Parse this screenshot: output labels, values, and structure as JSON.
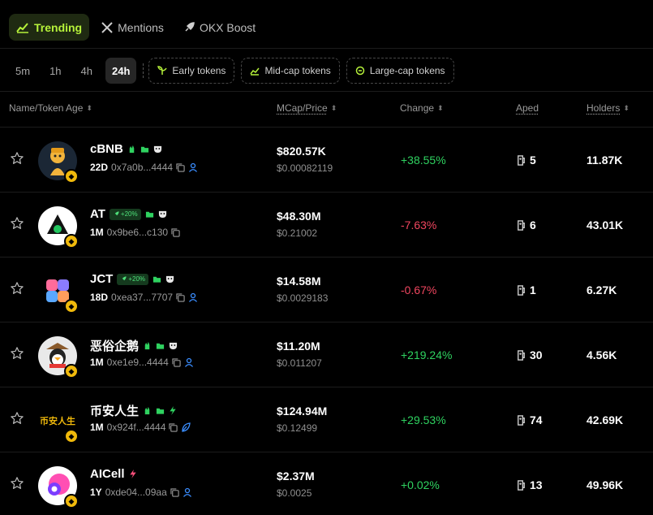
{
  "tabs": {
    "trending": "Trending",
    "mentions": "Mentions",
    "boost": "OKX Boost"
  },
  "time_filters": [
    "5m",
    "1h",
    "4h",
    "24h"
  ],
  "active_time_filter": "24h",
  "chips": {
    "early": "Early tokens",
    "mid": "Mid-cap tokens",
    "large": "Large-cap tokens"
  },
  "headers": {
    "name": "Name/Token Age",
    "mcap": "MCap/Price",
    "change": "Change",
    "aped": "Aped",
    "holders": "Holders"
  },
  "boost_label": "+20%",
  "avatar_text": {
    "bian": "币安人生"
  },
  "colors": {
    "accent": "#b6f23a",
    "up": "#2fd260",
    "down": "#f0465f",
    "bnb": "#f0b90b"
  },
  "rows": [
    {
      "name": "cBNB",
      "age": "22D",
      "addr": "0x7a0b...4444",
      "mcap": "$820.57K",
      "price": "$0.00082119",
      "change": "+38.55%",
      "dir": "up",
      "aped": "5",
      "holders": "11.87K"
    },
    {
      "name": "AT",
      "age": "1M",
      "addr": "0x9be6...c130",
      "mcap": "$48.30M",
      "price": "$0.21002",
      "change": "-7.63%",
      "dir": "down",
      "aped": "6",
      "holders": "43.01K"
    },
    {
      "name": "JCT",
      "age": "18D",
      "addr": "0xea37...7707",
      "mcap": "$14.58M",
      "price": "$0.0029183",
      "change": "-0.67%",
      "dir": "down",
      "aped": "1",
      "holders": "6.27K"
    },
    {
      "name": "恶俗企鹅",
      "age": "1M",
      "addr": "0xe1e9...4444",
      "mcap": "$11.20M",
      "price": "$0.011207",
      "change": "+219.24%",
      "dir": "up",
      "aped": "30",
      "holders": "4.56K"
    },
    {
      "name": "币安人生",
      "age": "1M",
      "addr": "0x924f...4444",
      "mcap": "$124.94M",
      "price": "$0.12499",
      "change": "+29.53%",
      "dir": "up",
      "aped": "74",
      "holders": "42.69K"
    },
    {
      "name": "AICell",
      "age": "1Y",
      "addr": "0xde04...09aa",
      "mcap": "$2.37M",
      "price": "$0.0025",
      "change": "+0.02%",
      "dir": "up",
      "aped": "13",
      "holders": "49.96K"
    }
  ]
}
